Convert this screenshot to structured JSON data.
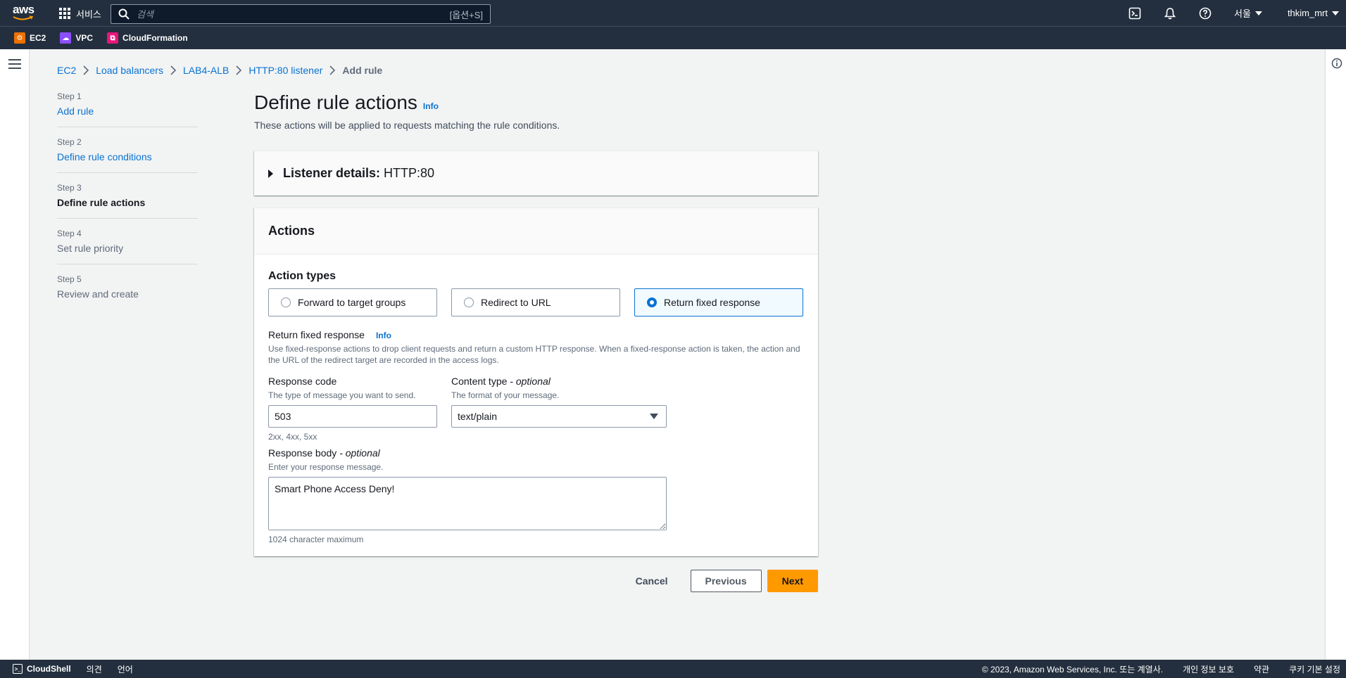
{
  "topnav": {
    "logo_text": "aws",
    "services_label": "서비스",
    "search_placeholder": "검색",
    "search_shortcut": "[옵션+S]",
    "region": "서울",
    "user": "thkim_mrt"
  },
  "favorites": [
    {
      "label": "EC2",
      "color": "#ed7100",
      "icon": "ec2-icon"
    },
    {
      "label": "VPC",
      "color": "#8c4fff",
      "icon": "vpc-icon"
    },
    {
      "label": "CloudFormation",
      "color": "#e7157b",
      "icon": "cloudformation-icon"
    }
  ],
  "breadcrumb": {
    "items": [
      "EC2",
      "Load balancers",
      "LAB4-ALB",
      "HTTP:80 listener"
    ],
    "current": "Add rule"
  },
  "steps": [
    {
      "num": "Step 1",
      "label": "Add rule"
    },
    {
      "num": "Step 2",
      "label": "Define rule conditions"
    },
    {
      "num": "Step 3",
      "label": "Define rule actions"
    },
    {
      "num": "Step 4",
      "label": "Set rule priority"
    },
    {
      "num": "Step 5",
      "label": "Review and create"
    }
  ],
  "main": {
    "title": "Define rule actions",
    "info": "Info",
    "description": "These actions will be applied to requests matching the rule conditions.",
    "listener_label": "Listener details:",
    "listener_value": "HTTP:80",
    "actions_header": "Actions",
    "action_types_title": "Action types",
    "action_types": [
      "Forward to target groups",
      "Redirect to URL",
      "Return fixed response"
    ],
    "selected_action_index": 2,
    "fixed_title": "Return fixed response",
    "fixed_info": "Info",
    "fixed_help": "Use fixed-response actions to drop client requests and return a custom HTTP response. When a fixed-response action is taken, the action and the URL of the redirect target are recorded in the access logs.",
    "response_code_label": "Response code",
    "response_code_help": "The type of message you want to send.",
    "response_code_value": "503",
    "response_code_constraint": "2xx, 4xx, 5xx",
    "content_type_label": "Content type",
    "content_type_optional": "- optional",
    "content_type_help": "The format of your message.",
    "content_type_value": "text/plain",
    "body_label": "Response body",
    "body_optional": "- optional",
    "body_help": "Enter your response message.",
    "body_value": "Smart Phone Access Deny!",
    "body_constraint": "1024 character maximum"
  },
  "buttons": {
    "cancel": "Cancel",
    "previous": "Previous",
    "next": "Next"
  },
  "footer": {
    "cloudshell": "CloudShell",
    "feedback": "의견",
    "language": "언어",
    "copyright": "© 2023, Amazon Web Services, Inc. 또는 계열사.",
    "privacy": "개인 정보 보호",
    "terms": "약관",
    "cookies": "쿠키 기본 설정"
  }
}
